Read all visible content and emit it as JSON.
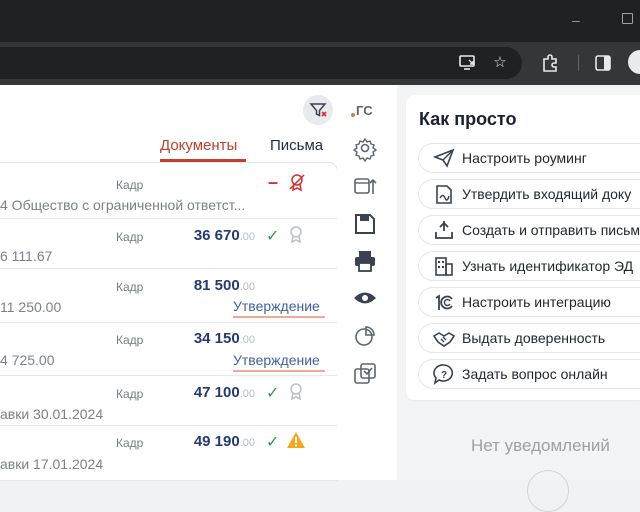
{
  "toolbar": {
    "filter_tooltip": "filter",
    "gc_label": "ГС"
  },
  "tabs": {
    "documents": "Документы",
    "letters": "Письма"
  },
  "table": {
    "header": {
      "kadr": "Кадр",
      "subtitle": "4 Общество с ограниченной ответст..."
    },
    "rows": [
      {
        "kadr": "Кадр",
        "sub": "6 111.67",
        "amount": "36 670",
        "dec": ".00",
        "status": ""
      },
      {
        "kadr": "Кадр",
        "sub": "11 250.00",
        "amount": "81 500",
        "dec": ".00",
        "status": "Утверждение"
      },
      {
        "kadr": "Кадр",
        "sub": "4 725.00",
        "amount": "34 150",
        "dec": ".00",
        "status": "Утверждение"
      },
      {
        "kadr": "Кадр",
        "sub": "авки 30.01.2024",
        "amount": "47 100",
        "dec": ".00",
        "status": ""
      },
      {
        "kadr": "Кадр",
        "sub": "авки 17.01.2024",
        "amount": "49 190",
        "dec": ".00",
        "status": ""
      }
    ],
    "check_mark": "✓",
    "minus_mark": "–"
  },
  "howto": {
    "title": "Как просто",
    "actions": [
      {
        "label": "Настроить роуминг",
        "icon": "paper-plane-icon"
      },
      {
        "label": "Утвердить входящий доку",
        "icon": "sign-document-icon"
      },
      {
        "label": "Создать и отправить письм",
        "icon": "upload-tray-icon"
      },
      {
        "label": "Узнать идентификатор ЭД",
        "icon": "building-icon"
      },
      {
        "label": "Настроить интеграцию",
        "icon": "1c-icon"
      },
      {
        "label": "Выдать доверенность",
        "icon": "handshake-icon"
      },
      {
        "label": "Задать вопрос онлайн",
        "icon": "question-icon"
      }
    ]
  },
  "notifications": {
    "empty": "Нет уведомлений"
  },
  "colors": {
    "accent": "#c0402a",
    "amount": "#243a73",
    "ok": "#2e9e4a",
    "warning": "#f2a818"
  }
}
